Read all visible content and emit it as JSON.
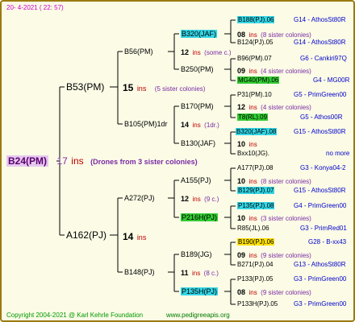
{
  "header": {
    "date": "20- 4-2021 ( 22: 57)"
  },
  "tree": {
    "root": {
      "name": "B24(PM)",
      "ins": "17",
      "note": "(Drones from 3 sister colonies)"
    },
    "gen1": [
      {
        "name": "B53(PM)",
        "ins": "15",
        "note": "(5 sister colonies)"
      },
      {
        "name": "A162(PJ)",
        "ins": "14",
        "note": ""
      }
    ],
    "gen2": [
      {
        "name": "B56(PM)",
        "ins": "12",
        "note": "(some c.)"
      },
      {
        "name": "B105(PM)1dr",
        "ins": "14",
        "note": "(1dr.)"
      },
      {
        "name": "A272(PJ)",
        "ins": "12",
        "note": "(9 c.)"
      },
      {
        "name": "B148(PJ)",
        "ins": "11",
        "note": "(8 c.)"
      }
    ],
    "gen3": [
      {
        "name": "B320(JAF)",
        "ins": "08",
        "note": "(8 sister colonies)"
      },
      {
        "name": "B250(PM)",
        "ins": "09",
        "note": "(4 sister colonies)"
      },
      {
        "name": "B170(PM)",
        "ins": "12",
        "note": "(4 sister colonies)"
      },
      {
        "name": "B130(JAF)",
        "ins": "10",
        "note": ""
      },
      {
        "name": "A155(PJ)",
        "ins": "10",
        "note": "(8 sister colonies)"
      },
      {
        "name": "P216H(PJ)",
        "ins": "10",
        "note": "(3 sister colonies)"
      },
      {
        "name": "B189(JG)",
        "ins": "09",
        "note": "(9 sister colonies)"
      },
      {
        "name": "P135H(PJ)",
        "ins": "08",
        "note": "(9 sister colonies)"
      }
    ],
    "gen4": [
      {
        "name": "B188(PJ).06",
        "line": "G14 - AthosSt80R"
      },
      {
        "name": "B124(PJ).05",
        "line": "G14 - AthosSt80R"
      },
      {
        "name": "B96(PM).07",
        "line": "G6 - Cankiri97Q"
      },
      {
        "name": "MG40(PM).06",
        "line": "G4 - MG00R"
      },
      {
        "name": "P31(PM).10",
        "line": "G5 - PrimGreen00"
      },
      {
        "name": "T8(RL).09",
        "line": "G5 - Athos00R"
      },
      {
        "name": "B320(JAF).08",
        "line": "G15 - AthosSt80R"
      },
      {
        "name": "Bxx10(JG).",
        "line": "no more"
      },
      {
        "name": "A177(PJ).08",
        "line": "G3 - Konya04-2"
      },
      {
        "name": "B129(PJ).07",
        "line": "G15 - AthosSt80R"
      },
      {
        "name": "P135(PJ).08",
        "line": "G4 - PrimGreen00"
      },
      {
        "name": "R85(JL).06",
        "line": "G3 - PrimRed01"
      },
      {
        "name": "B190(PJ).06",
        "line": "G28 - B-xx43"
      },
      {
        "name": "B271(PJ).04",
        "line": "G13 - AthosSt80R"
      },
      {
        "name": "P133(PJ).05",
        "line": "G3 - PrimGreen00"
      },
      {
        "name": "P133H(PJ).05",
        "line": "G3 - PrimGreen00"
      }
    ],
    "ins_label": "ins"
  },
  "footer": {
    "copyright": "Copyright 2004-2021 @ Karl Kehrle Foundation",
    "url": "www.pedigreeapis.org"
  }
}
